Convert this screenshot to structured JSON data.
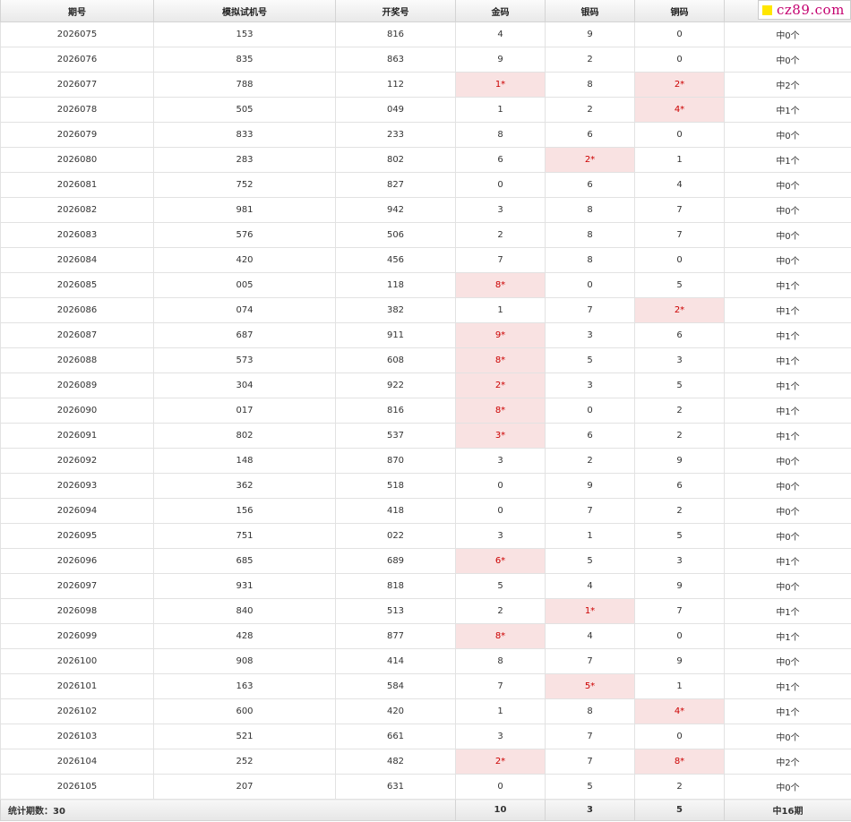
{
  "watermark": {
    "text": "cz89.com",
    "color": "#c4006f",
    "mark_color": "#ffe600"
  },
  "colors": {
    "hit_bg": "#f9e2e2",
    "hit_text": "#cc0000"
  },
  "headers": [
    "期号",
    "模拟试机号",
    "开奖号",
    "金码",
    "银码",
    "铜码",
    ""
  ],
  "rows": [
    {
      "issue": "2026075",
      "sim": "153",
      "draw": "816",
      "gold": "4",
      "silver": "9",
      "bronze": "0",
      "result": "中0个",
      "hits": []
    },
    {
      "issue": "2026076",
      "sim": "835",
      "draw": "863",
      "gold": "9",
      "silver": "2",
      "bronze": "0",
      "result": "中0个",
      "hits": []
    },
    {
      "issue": "2026077",
      "sim": "788",
      "draw": "112",
      "gold": "1*",
      "silver": "8",
      "bronze": "2*",
      "result": "中2个",
      "hits": [
        "gold",
        "bronze"
      ]
    },
    {
      "issue": "2026078",
      "sim": "505",
      "draw": "049",
      "gold": "1",
      "silver": "2",
      "bronze": "4*",
      "result": "中1个",
      "hits": [
        "bronze"
      ]
    },
    {
      "issue": "2026079",
      "sim": "833",
      "draw": "233",
      "gold": "8",
      "silver": "6",
      "bronze": "0",
      "result": "中0个",
      "hits": []
    },
    {
      "issue": "2026080",
      "sim": "283",
      "draw": "802",
      "gold": "6",
      "silver": "2*",
      "bronze": "1",
      "result": "中1个",
      "hits": [
        "silver"
      ]
    },
    {
      "issue": "2026081",
      "sim": "752",
      "draw": "827",
      "gold": "0",
      "silver": "6",
      "bronze": "4",
      "result": "中0个",
      "hits": []
    },
    {
      "issue": "2026082",
      "sim": "981",
      "draw": "942",
      "gold": "3",
      "silver": "8",
      "bronze": "7",
      "result": "中0个",
      "hits": []
    },
    {
      "issue": "2026083",
      "sim": "576",
      "draw": "506",
      "gold": "2",
      "silver": "8",
      "bronze": "7",
      "result": "中0个",
      "hits": []
    },
    {
      "issue": "2026084",
      "sim": "420",
      "draw": "456",
      "gold": "7",
      "silver": "8",
      "bronze": "0",
      "result": "中0个",
      "hits": []
    },
    {
      "issue": "2026085",
      "sim": "005",
      "draw": "118",
      "gold": "8*",
      "silver": "0",
      "bronze": "5",
      "result": "中1个",
      "hits": [
        "gold"
      ]
    },
    {
      "issue": "2026086",
      "sim": "074",
      "draw": "382",
      "gold": "1",
      "silver": "7",
      "bronze": "2*",
      "result": "中1个",
      "hits": [
        "bronze"
      ]
    },
    {
      "issue": "2026087",
      "sim": "687",
      "draw": "911",
      "gold": "9*",
      "silver": "3",
      "bronze": "6",
      "result": "中1个",
      "hits": [
        "gold"
      ]
    },
    {
      "issue": "2026088",
      "sim": "573",
      "draw": "608",
      "gold": "8*",
      "silver": "5",
      "bronze": "3",
      "result": "中1个",
      "hits": [
        "gold"
      ]
    },
    {
      "issue": "2026089",
      "sim": "304",
      "draw": "922",
      "gold": "2*",
      "silver": "3",
      "bronze": "5",
      "result": "中1个",
      "hits": [
        "gold"
      ]
    },
    {
      "issue": "2026090",
      "sim": "017",
      "draw": "816",
      "gold": "8*",
      "silver": "0",
      "bronze": "2",
      "result": "中1个",
      "hits": [
        "gold"
      ]
    },
    {
      "issue": "2026091",
      "sim": "802",
      "draw": "537",
      "gold": "3*",
      "silver": "6",
      "bronze": "2",
      "result": "中1个",
      "hits": [
        "gold"
      ]
    },
    {
      "issue": "2026092",
      "sim": "148",
      "draw": "870",
      "gold": "3",
      "silver": "2",
      "bronze": "9",
      "result": "中0个",
      "hits": []
    },
    {
      "issue": "2026093",
      "sim": "362",
      "draw": "518",
      "gold": "0",
      "silver": "9",
      "bronze": "6",
      "result": "中0个",
      "hits": []
    },
    {
      "issue": "2026094",
      "sim": "156",
      "draw": "418",
      "gold": "0",
      "silver": "7",
      "bronze": "2",
      "result": "中0个",
      "hits": []
    },
    {
      "issue": "2026095",
      "sim": "751",
      "draw": "022",
      "gold": "3",
      "silver": "1",
      "bronze": "5",
      "result": "中0个",
      "hits": []
    },
    {
      "issue": "2026096",
      "sim": "685",
      "draw": "689",
      "gold": "6*",
      "silver": "5",
      "bronze": "3",
      "result": "中1个",
      "hits": [
        "gold"
      ]
    },
    {
      "issue": "2026097",
      "sim": "931",
      "draw": "818",
      "gold": "5",
      "silver": "4",
      "bronze": "9",
      "result": "中0个",
      "hits": []
    },
    {
      "issue": "2026098",
      "sim": "840",
      "draw": "513",
      "gold": "2",
      "silver": "1*",
      "bronze": "7",
      "result": "中1个",
      "hits": [
        "silver"
      ]
    },
    {
      "issue": "2026099",
      "sim": "428",
      "draw": "877",
      "gold": "8*",
      "silver": "4",
      "bronze": "0",
      "result": "中1个",
      "hits": [
        "gold"
      ]
    },
    {
      "issue": "2026100",
      "sim": "908",
      "draw": "414",
      "gold": "8",
      "silver": "7",
      "bronze": "9",
      "result": "中0个",
      "hits": []
    },
    {
      "issue": "2026101",
      "sim": "163",
      "draw": "584",
      "gold": "7",
      "silver": "5*",
      "bronze": "1",
      "result": "中1个",
      "hits": [
        "silver"
      ]
    },
    {
      "issue": "2026102",
      "sim": "600",
      "draw": "420",
      "gold": "1",
      "silver": "8",
      "bronze": "4*",
      "result": "中1个",
      "hits": [
        "bronze"
      ]
    },
    {
      "issue": "2026103",
      "sim": "521",
      "draw": "661",
      "gold": "3",
      "silver": "7",
      "bronze": "0",
      "result": "中0个",
      "hits": []
    },
    {
      "issue": "2026104",
      "sim": "252",
      "draw": "482",
      "gold": "2*",
      "silver": "7",
      "bronze": "8*",
      "result": "中2个",
      "hits": [
        "gold",
        "bronze"
      ]
    },
    {
      "issue": "2026105",
      "sim": "207",
      "draw": "631",
      "gold": "0",
      "silver": "5",
      "bronze": "2",
      "result": "中0个",
      "hits": []
    }
  ],
  "footer": {
    "label": "统计期数：30",
    "gold_total": "10",
    "silver_total": "3",
    "bronze_total": "5",
    "result_total": "中16期"
  }
}
